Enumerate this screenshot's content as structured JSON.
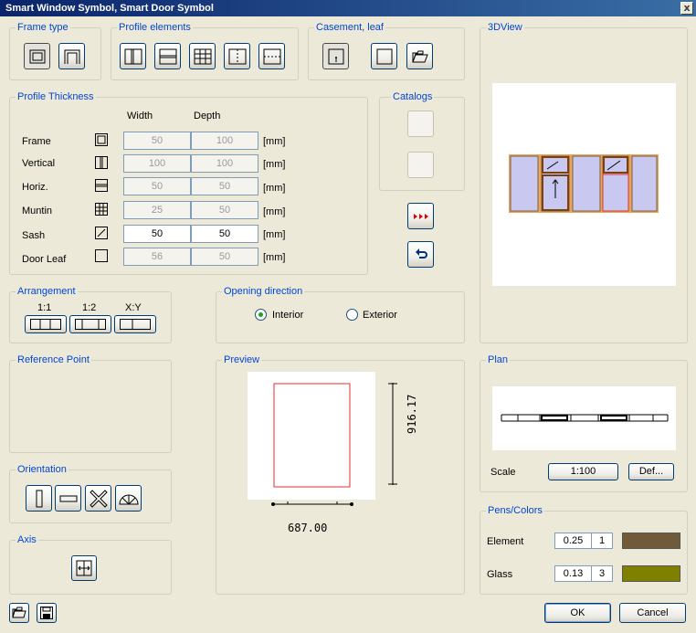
{
  "title": "Smart Window Symbol, Smart Door Symbol",
  "close_glyph": "x",
  "groups": {
    "frame_type": "Frame type",
    "profile_elements": "Profile elements",
    "casement": "Casement, leaf",
    "view3d": "3DView",
    "profile_thickness": "Profile Thickness",
    "catalogs": "Catalogs",
    "arrangement": "Arrangement",
    "opening_direction": "Opening direction",
    "reference_point": "Reference Point",
    "preview": "Preview",
    "plan": "Plan",
    "orientation": "Orientation",
    "pens_colors": "Pens/Colors",
    "axis": "Axis"
  },
  "thickness": {
    "col_width": "Width",
    "col_depth": "Depth",
    "unit": "[mm]",
    "rows": [
      {
        "label": "Frame",
        "width": "50",
        "depth": "100",
        "enabled": false,
        "icon": "frame-icon"
      },
      {
        "label": "Vertical",
        "width": "100",
        "depth": "100",
        "enabled": false,
        "icon": "vertical-icon"
      },
      {
        "label": "Horiz.",
        "width": "50",
        "depth": "50",
        "enabled": false,
        "icon": "horizontal-icon"
      },
      {
        "label": "Muntin",
        "width": "25",
        "depth": "50",
        "enabled": false,
        "icon": "muntin-icon"
      },
      {
        "label": "Sash",
        "width": "50",
        "depth": "50",
        "enabled": true,
        "icon": "sash-icon"
      },
      {
        "label": "Door Leaf",
        "width": "56",
        "depth": "50",
        "enabled": false,
        "icon": "door-leaf-icon"
      }
    ]
  },
  "arrangement": {
    "labels": [
      "1:1",
      "1:2",
      "X:Y"
    ]
  },
  "opening": {
    "interior": "Interior",
    "exterior": "Exterior",
    "selected": "interior"
  },
  "preview": {
    "height_dim": "916.17",
    "width_dim": "687.00"
  },
  "plan": {
    "scale_label": "Scale",
    "scale_value": "1:100",
    "def_label": "Def..."
  },
  "pens": {
    "element_label": "Element",
    "element_pen": "0.25",
    "element_num": "1",
    "element_color": "#6f5a3a",
    "glass_label": "Glass",
    "glass_pen": "0.13",
    "glass_num": "3",
    "glass_color": "#808000"
  },
  "buttons": {
    "ok": "OK",
    "cancel": "Cancel"
  },
  "colors": {
    "accent": "#0046d5",
    "frame_red": "#e03030",
    "glass": "#c8c8f0"
  }
}
